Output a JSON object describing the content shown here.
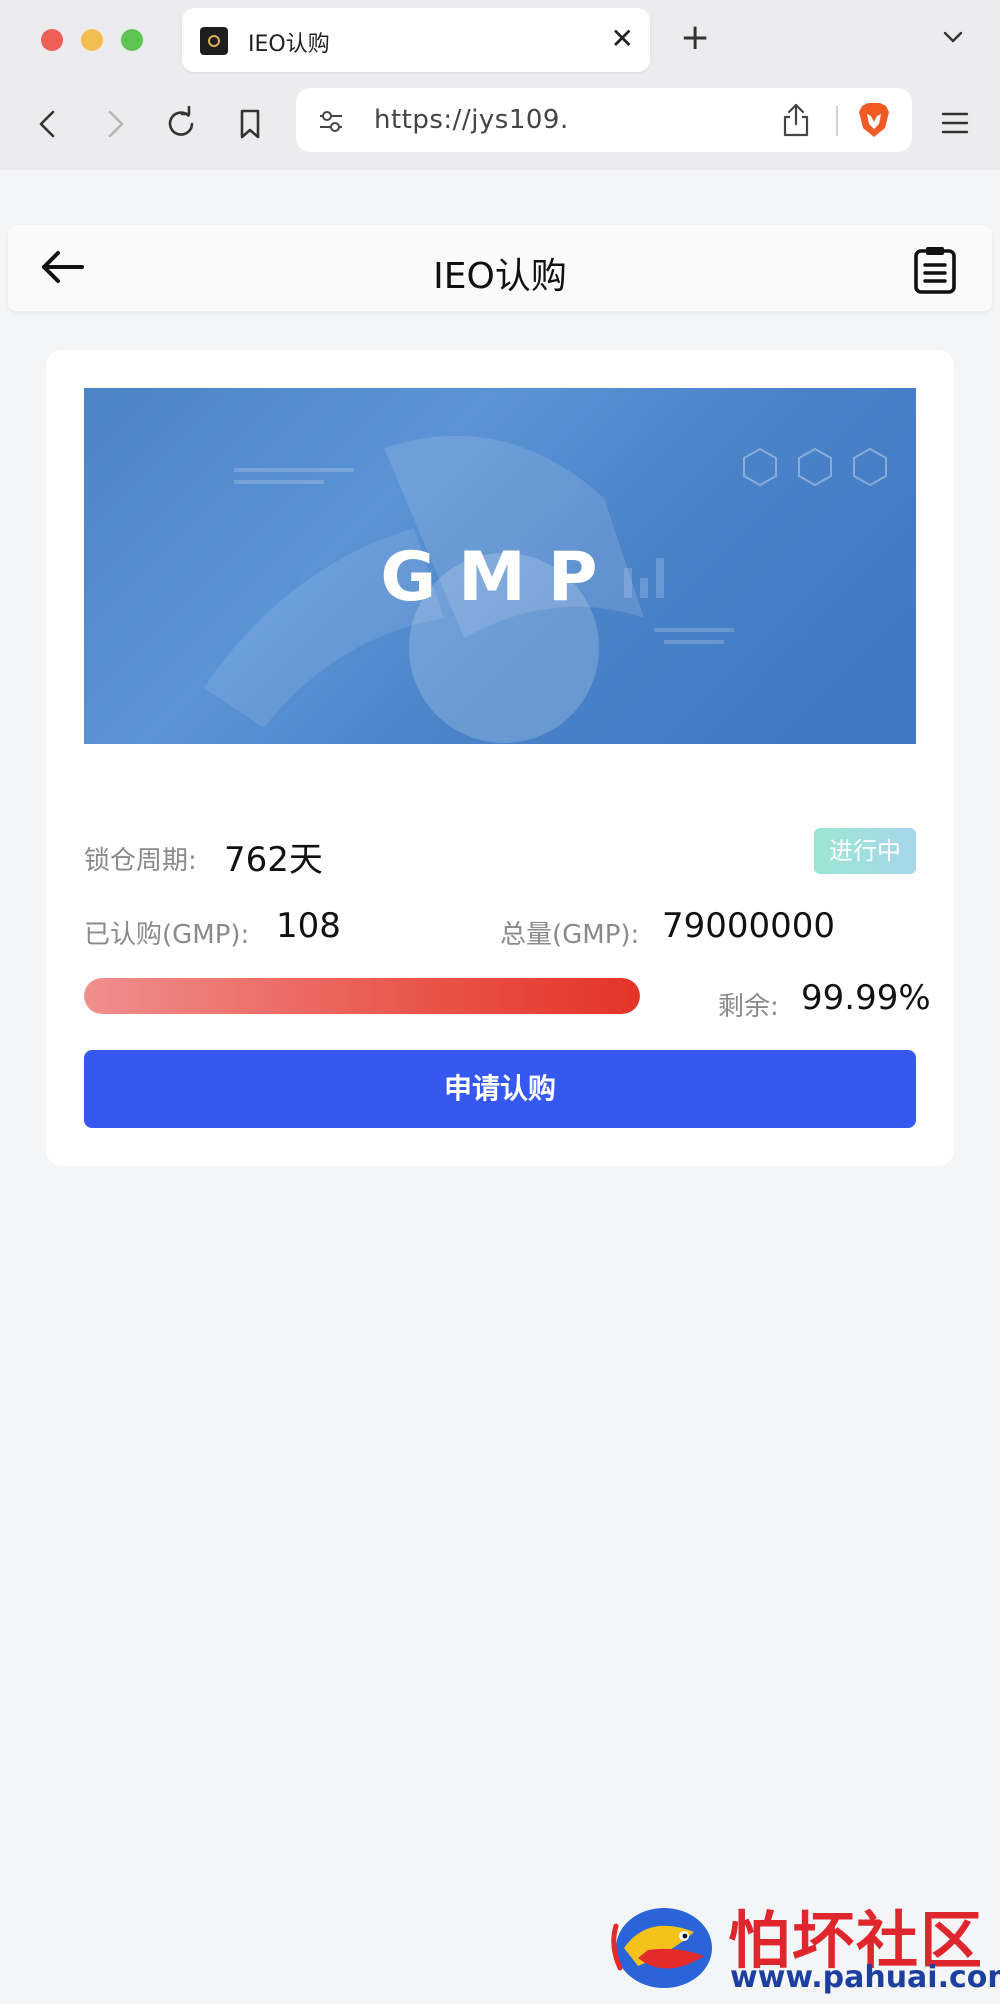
{
  "browser": {
    "tab_title": "IEO认购",
    "tab_close": "✕",
    "new_tab": "+",
    "url": "https://jys109."
  },
  "app": {
    "title": "IEO认购"
  },
  "card": {
    "banner_text": "GMP",
    "lock_label": "锁仓周期:",
    "lock_value": "762天",
    "status": "进行中",
    "subscribed_label": "已认购(GMP):",
    "subscribed_value": "108",
    "total_label": "总量(GMP):",
    "total_value": "79000000",
    "remaining_label": "剩余:",
    "remaining_value": "99.99%",
    "progress_fraction": 1.0,
    "button_label": "申请认购"
  },
  "watermark": {
    "name": "怕坏社区",
    "url": "www.pahuai.com"
  },
  "colors": {
    "primary_button": "#3559f0",
    "progress_end": "#e43328",
    "status_badge": "#9be6d3",
    "banner": "#4d84c8"
  },
  "icons": [
    "back-arrow-icon",
    "forward-arrow-icon",
    "reload-icon",
    "bookmark-icon",
    "tune-icon",
    "share-icon",
    "brave-lion-icon",
    "hamburger-menu-icon",
    "chevron-down-icon",
    "clipboard-list-icon"
  ]
}
